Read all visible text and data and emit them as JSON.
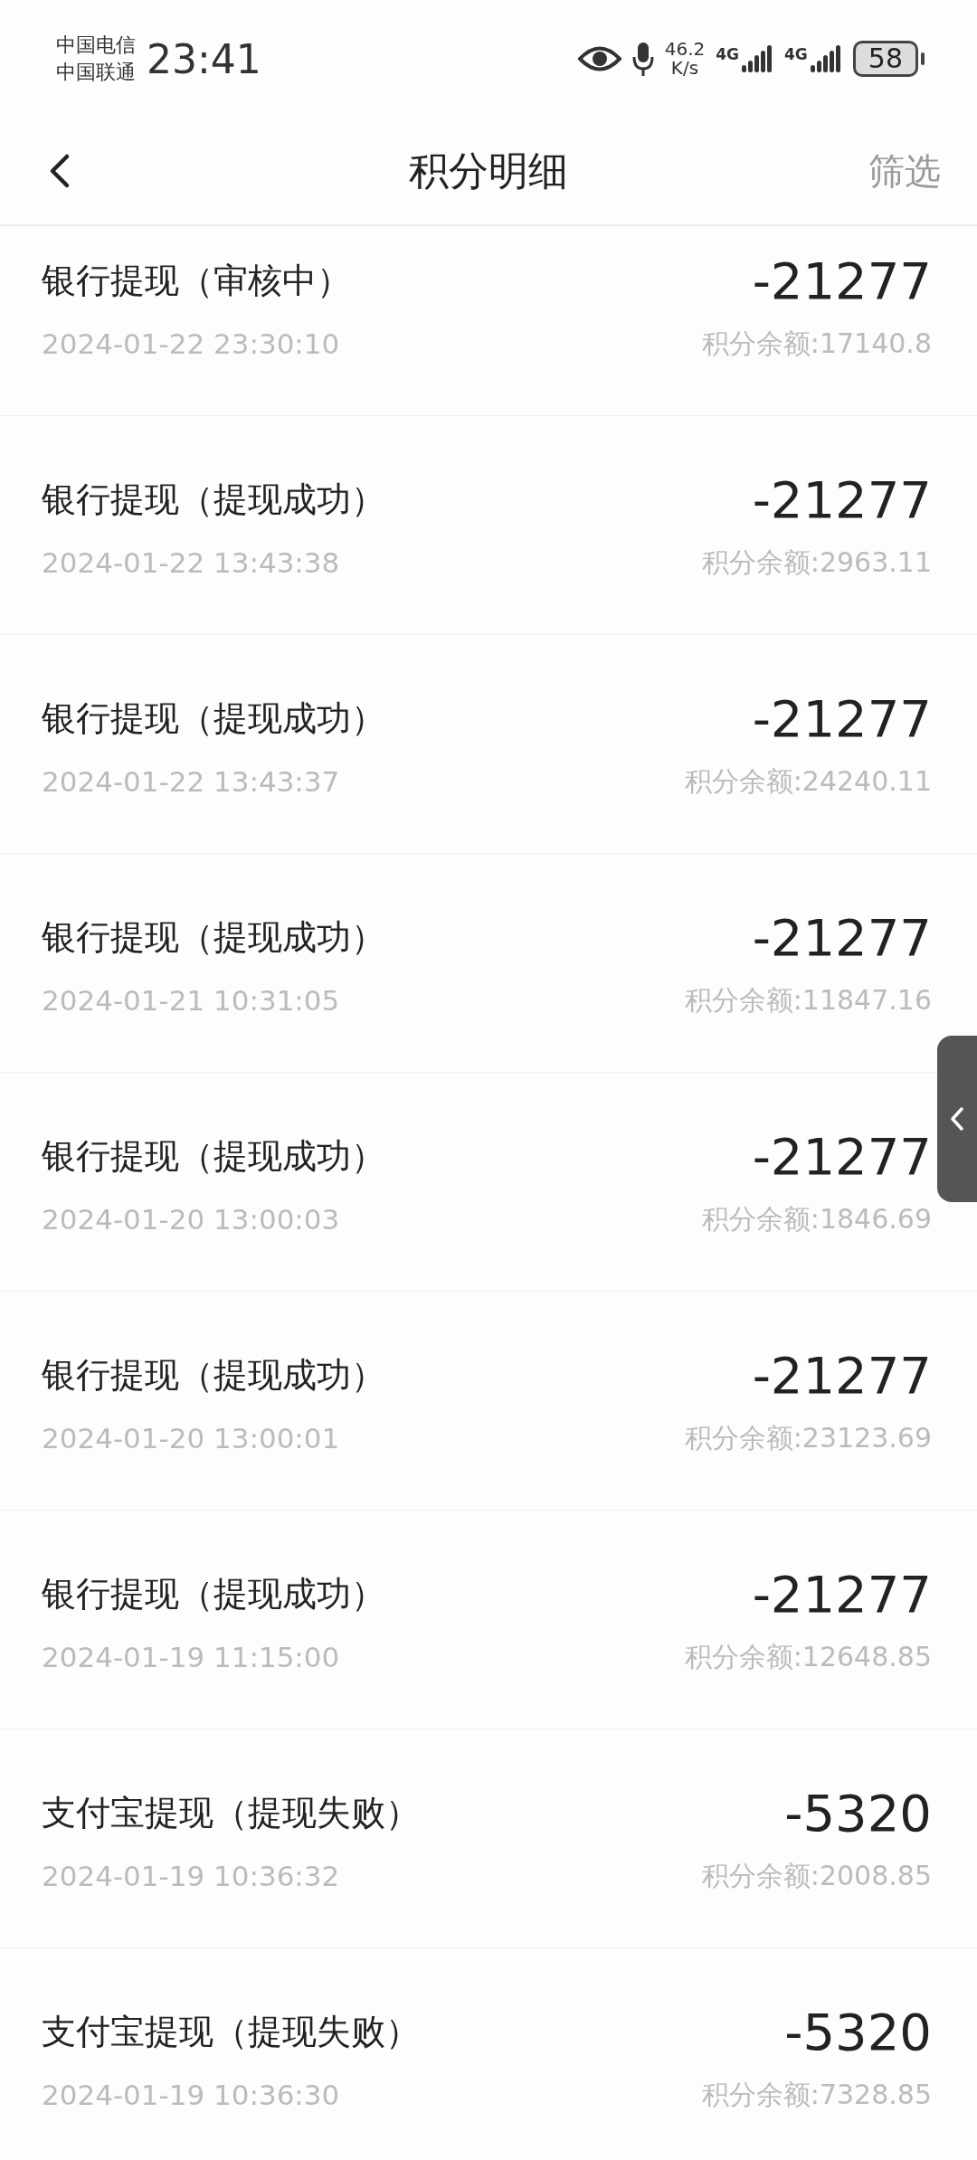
{
  "status_bar": {
    "carriers": [
      "中国电信",
      "中国联通"
    ],
    "time": "23:41",
    "net_speed": [
      "46.2",
      "K/s"
    ],
    "signals": [
      {
        "label": "4G"
      },
      {
        "label": "4G"
      }
    ],
    "battery": "58"
  },
  "header": {
    "title": "积分明细",
    "action": "筛选"
  },
  "records": [
    {
      "title": "银行提现（审核中）",
      "time": "2024-01-22 23:30:10",
      "amount": "-21277",
      "balance": "积分余额:17140.8"
    },
    {
      "title": "银行提现（提现成功）",
      "time": "2024-01-22 13:43:38",
      "amount": "-21277",
      "balance": "积分余额:2963.11"
    },
    {
      "title": "银行提现（提现成功）",
      "time": "2024-01-22 13:43:37",
      "amount": "-21277",
      "balance": "积分余额:24240.11"
    },
    {
      "title": "银行提现（提现成功）",
      "time": "2024-01-21 10:31:05",
      "amount": "-21277",
      "balance": "积分余额:11847.16"
    },
    {
      "title": "银行提现（提现成功）",
      "time": "2024-01-20 13:00:03",
      "amount": "-21277",
      "balance": "积分余额:1846.69"
    },
    {
      "title": "银行提现（提现成功）",
      "time": "2024-01-20 13:00:01",
      "amount": "-21277",
      "balance": "积分余额:23123.69"
    },
    {
      "title": "银行提现（提现成功）",
      "time": "2024-01-19 11:15:00",
      "amount": "-21277",
      "balance": "积分余额:12648.85"
    },
    {
      "title": "支付宝提现（提现失败）",
      "time": "2024-01-19 10:36:32",
      "amount": "-5320",
      "balance": "积分余额:2008.85"
    },
    {
      "title": "支付宝提现（提现失败）",
      "time": "2024-01-19 10:36:30",
      "amount": "-5320",
      "balance": "积分余额:7328.85"
    }
  ]
}
